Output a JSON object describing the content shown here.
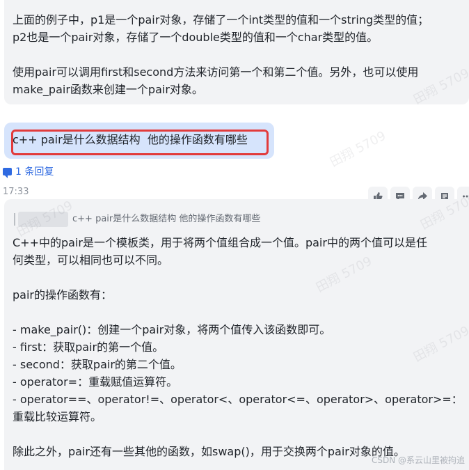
{
  "top_message": {
    "lines": [
      "上面的例子中，p1是一个pair对象，存储了一个int类型的值和一个string类型的值；",
      "p2也是一个pair对象，存储了一个double类型的值和一个char类型的值。",
      "使用pair可以调用first和second方法来访问第一个和第二个值。另外，也可以使用",
      "make_pair函数来创建一个pair对象。"
    ]
  },
  "question_bubble": {
    "text": "c++ pair是什么数据结构  他的操作函数有哪些",
    "highlight_color": "#e23b3b"
  },
  "reply_link": {
    "label": "1 条回复"
  },
  "timestamp": "17:33",
  "action_icons": [
    "thumbs-up-icon",
    "comment-icon",
    "forward-icon",
    "quote-icon",
    "more-icon"
  ],
  "answer": {
    "quote": "c++ pair是什么数据结构 他的操作函数有哪些",
    "lines": [
      "C++中的pair是一个模板类，用于将两个值组合成一个值。pair中的两个值可以是任",
      "何类型，可以相同也可以不同。",
      "pair的操作函数有：",
      "- make_pair()：创建一个pair对象，将两个值传入该函数即可。",
      "- first：获取pair的第一个值。",
      "- second：获取pair的第二个值。",
      "- operator=：重载赋值运算符。",
      "- operator==、operator!=、operator<、operator<=、operator>、operator>=：",
      "重载比较运算符。",
      "除此之外，pair还有一些其他的函数，如swap()，用于交换两个pair对象的值。"
    ]
  },
  "watermark_text": "田翔 5709",
  "footer": "CSDN @系云山里被拘追",
  "colors": {
    "accent": "#2f6ae1",
    "bubble": "#d6e4fc",
    "panel": "#f2f3f5"
  }
}
